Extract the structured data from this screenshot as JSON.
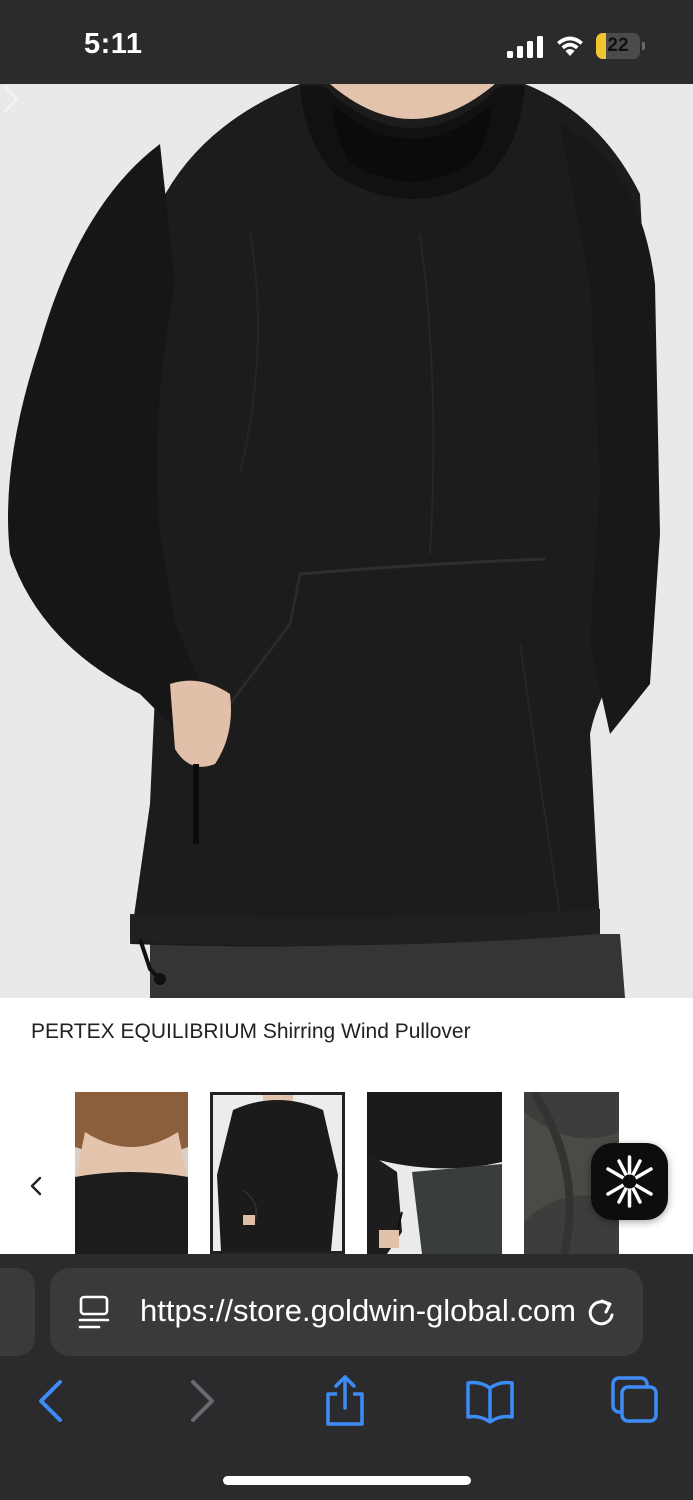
{
  "status_bar": {
    "time": "5:11",
    "battery_level": "22",
    "battery_fraction": 0.22,
    "battery_color": "#f2c52e"
  },
  "product": {
    "title": "PERTEX EQUILIBRIUM Shirring Wind Pullover",
    "main_image": "black-pullover-model-photo",
    "selected_thumbnail_index": 1,
    "thumbnails": [
      "back-view-photo",
      "front-view-photo",
      "drawcord-detail-photo",
      "fabric-detail-photo"
    ]
  },
  "browser": {
    "url": "https://store.goldwin-global.com"
  },
  "icons": {
    "signal": "cellular-signal-icon",
    "wifi": "wifi-icon",
    "zoom": "magnifier-icon",
    "app_badge": "asterisk-logo-icon",
    "back": "chevron-left-icon",
    "forward": "chevron-right-icon",
    "share": "share-icon",
    "bookmarks": "book-icon",
    "tabs": "tabs-icon",
    "reload": "reload-icon"
  }
}
